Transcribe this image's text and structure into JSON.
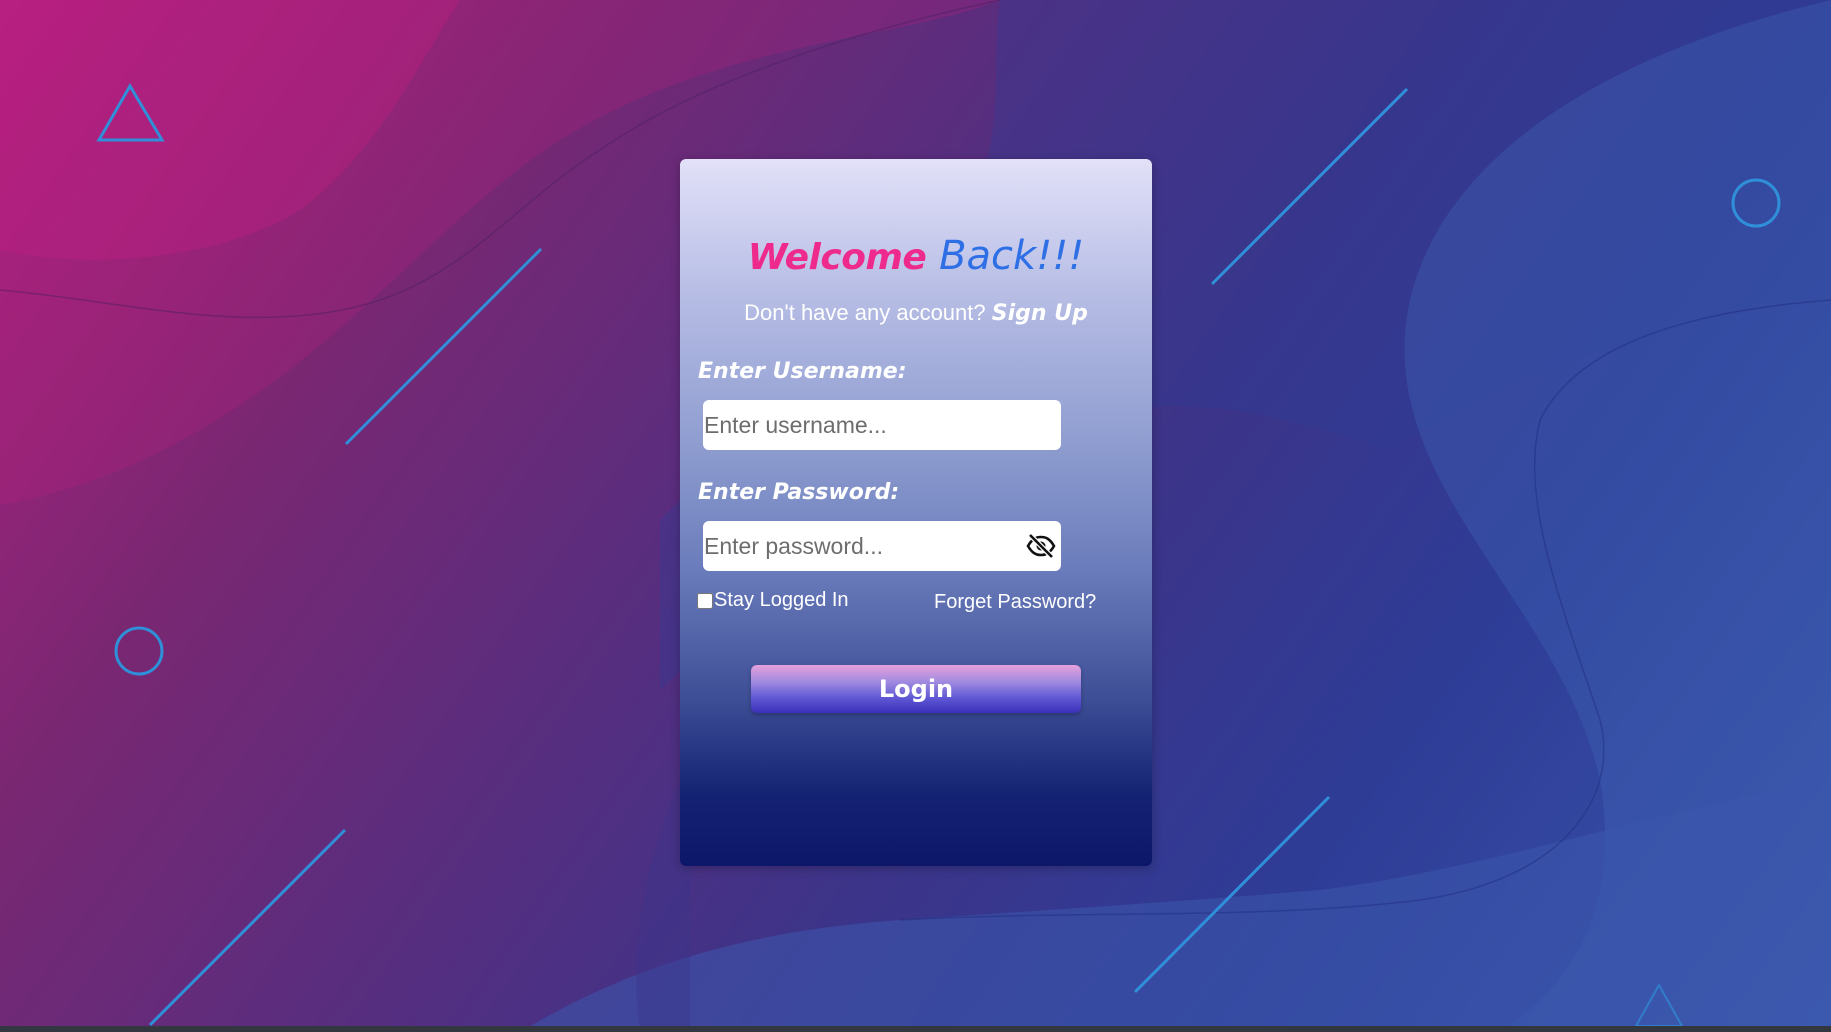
{
  "login": {
    "title_welcome": "Welcome",
    "title_back": "Back!!!",
    "no_account_text": "Don't have any account?",
    "signup_link": "Sign Up",
    "username_label": "Enter Username:",
    "username_placeholder": "Enter username...",
    "username_value": "",
    "password_label": "Enter Password:",
    "password_placeholder": "Enter password...",
    "password_value": "",
    "password_toggle_icon": "eye-slash-icon",
    "stay_logged_in_label": "Stay Logged In",
    "stay_logged_in_checked": false,
    "forget_password_link": "Forget Password?",
    "login_button": "Login"
  },
  "colors": {
    "welcome": "#ee2a8c",
    "back": "#2f6fe6",
    "decor_lines": "#2f8fd8",
    "card_top": "#e2e1f8",
    "card_bottom": "#0d176a",
    "button_top": "#e6a0dc",
    "button_bottom": "#3b2fb8"
  },
  "decorations": {
    "shapes": [
      "triangle-outline",
      "circle-outline",
      "diagonal-line"
    ]
  }
}
